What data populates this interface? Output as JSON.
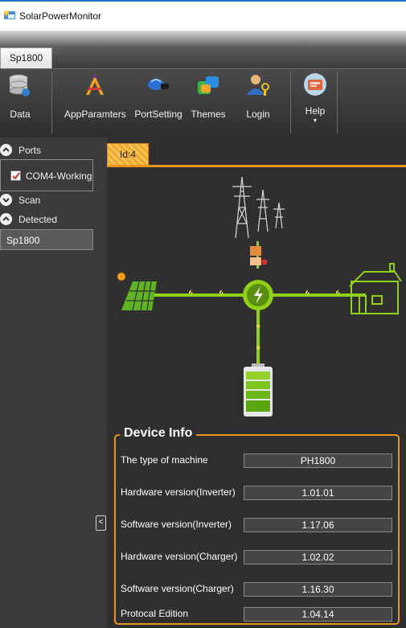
{
  "window": {
    "title": "SolarPowerMonitor"
  },
  "ribbon": {
    "tab": "Sp1800",
    "buttons": {
      "data": "Data",
      "app_params": "AppParamters",
      "port_setting": "PortSetting",
      "themes": "Themes",
      "login": "Login",
      "help": "Help"
    }
  },
  "sidebar": {
    "ports_label": "Ports",
    "port_item": "COM4-Working",
    "scan_label": "Scan",
    "detected_label": "Detected",
    "detected_item": "Sp1800",
    "collapse_glyph": "<"
  },
  "main": {
    "tab_label": "Id:4"
  },
  "device_info": {
    "title": "Device Info",
    "rows": [
      {
        "label": "The type of machine",
        "value": "PH1800"
      },
      {
        "label": "Hardware version(Inverter)",
        "value": "1.01.01"
      },
      {
        "label": "Software version(Inverter)",
        "value": "1.17.06"
      },
      {
        "label": "Hardware version(Charger)",
        "value": "1.02.02"
      },
      {
        "label": "Software version(Charger)",
        "value": "1.16.30"
      },
      {
        "label": "Protocal Edition",
        "value": "1.04.14"
      }
    ]
  },
  "colors": {
    "accent": "#e8941f",
    "energy_line": "#8fd116",
    "background": "#2f2f2f"
  },
  "icons": [
    "app-icon",
    "database-icon",
    "wrench-pencil-icon",
    "connector-icon",
    "palette-icon",
    "user-key-icon",
    "help-card-icon",
    "power-tower-icon",
    "solar-panel-icon",
    "inverter-hub-icon",
    "house-icon",
    "battery-icon"
  ]
}
